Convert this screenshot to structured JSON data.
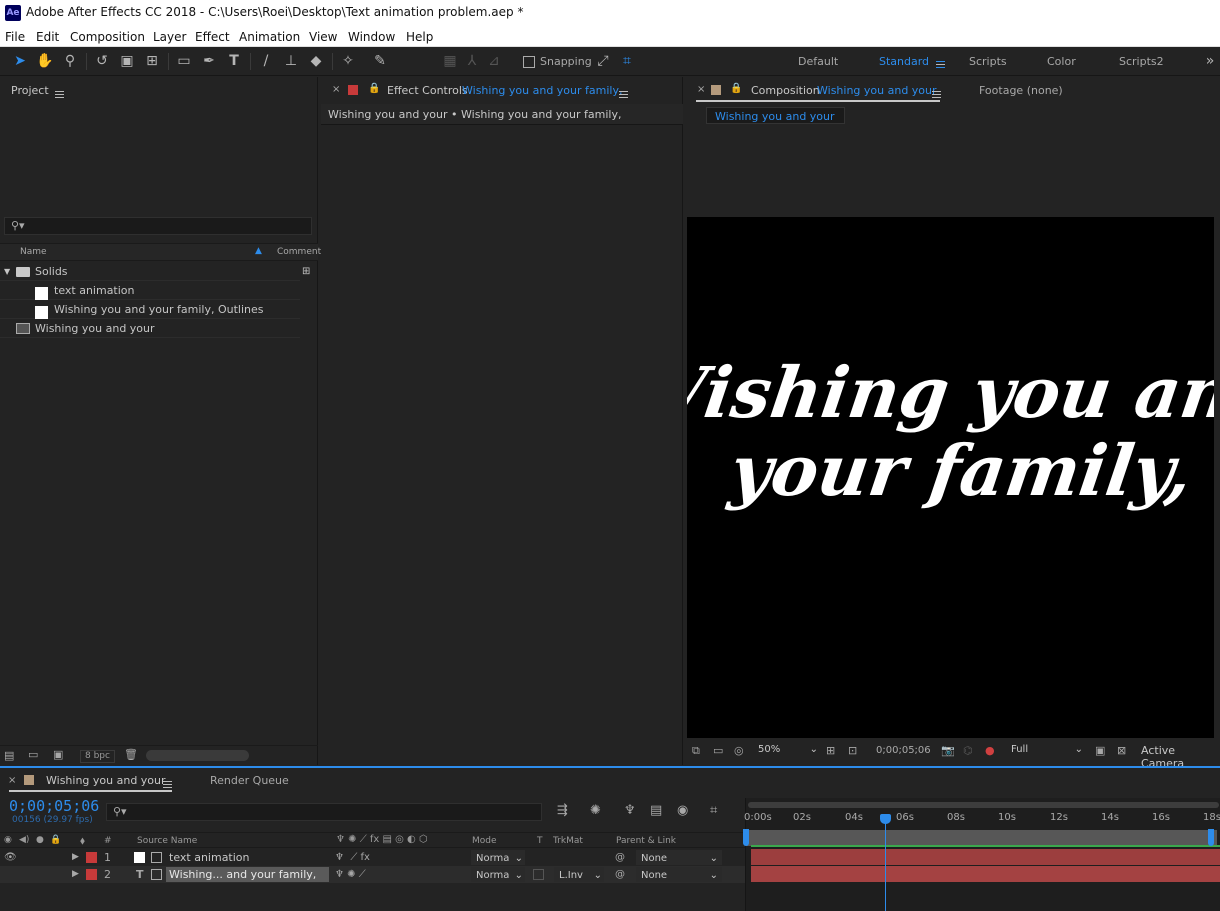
{
  "app": {
    "logo": "Ae",
    "title": "Adobe After Effects CC 2018 - C:\\Users\\Roei\\Desktop\\Text animation problem.aep *"
  },
  "menu": [
    "File",
    "Edit",
    "Composition",
    "Layer",
    "Effect",
    "Animation",
    "View",
    "Window",
    "Help"
  ],
  "toolbar": {
    "snapping": "Snapping",
    "workspaces": [
      "Default",
      "Standard",
      "Scripts",
      "Color",
      "Scripts2"
    ],
    "active_workspace": "Standard"
  },
  "project": {
    "title": "Project",
    "search_placeholder": "",
    "col_name": "Name",
    "col_comment": "Comment",
    "items": [
      {
        "name": "Solids",
        "type": "folder"
      },
      {
        "name": "text animation",
        "type": "solid"
      },
      {
        "name": "Wishing you and   your family, Outlines",
        "type": "solid"
      },
      {
        "name": "Wishing you and your",
        "type": "composition"
      }
    ],
    "bpc": "8 bpc"
  },
  "effect_controls": {
    "label": "Effect Controls",
    "layer": "Wishing you and   your family,",
    "breadcrumb": "Wishing you and your • Wishing you and   your family,"
  },
  "composition": {
    "label": "Composition",
    "name": "Wishing you and your",
    "footage_tab": "Footage (none)",
    "comp_tab": "Wishing you and your",
    "preview_line1": "Wishing you and",
    "preview_line2": "your family,",
    "zoom": "50%",
    "timecode": "0;00;05;06",
    "resolution": "Full",
    "camera": "Active Camera"
  },
  "timeline": {
    "tab": "Wishing you and your",
    "render_queue": "Render Queue",
    "timecode": "0;00;05;06",
    "frame_info": "00156 (29.97 fps)",
    "headers": {
      "num": "#",
      "source": "Source Name",
      "mode": "Mode",
      "t": "T",
      "trkmat": "TrkMat",
      "parent": "Parent & Link"
    },
    "layers": [
      {
        "num": "1",
        "name": "text animation",
        "mode": "Norma",
        "trkmat": "",
        "parent": "None"
      },
      {
        "num": "2",
        "name": "Wishing... and   your family,",
        "mode": "Norma",
        "trkmat": "L.Inv",
        "parent": "None"
      }
    ],
    "ruler": [
      "0:00s",
      "02s",
      "04s",
      "06s",
      "08s",
      "10s",
      "12s",
      "14s",
      "16s",
      "18s"
    ],
    "playhead_seconds": 5.2
  }
}
